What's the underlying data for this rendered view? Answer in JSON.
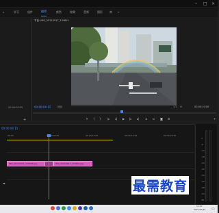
{
  "menu": {
    "items": [
      {
        "label": "学习",
        "active": false
      },
      {
        "label": "组件",
        "active": false
      },
      {
        "label": "编辑",
        "active": true
      },
      {
        "label": "颜色",
        "active": false
      },
      {
        "label": "效果",
        "active": false
      },
      {
        "label": "音频",
        "active": false
      },
      {
        "label": "图形",
        "active": false
      },
      {
        "label": "库",
        "active": false
      }
    ],
    "overflow": "»"
  },
  "program_monitor": {
    "title": "节目: IMG_20210917_134601",
    "timecode_current": "00:00:04:15",
    "fit_label": "适合",
    "quality_label": "1/2",
    "timecode_duration": "00:00:10:00"
  },
  "source_panel": {
    "timecode": "00:00:00:00"
  },
  "timeline": {
    "timecode": "00:00:04:15",
    "ruler_ticks": [
      "00:00",
      "00:00:05:00",
      "00:00:10:00",
      "00:00:15:00",
      "00:00:20:00",
      "00:00:25:00"
    ],
    "clips": [
      {
        "name": "IMG_20210917_134546.jpg"
      },
      {
        "name": "IMG_20210917_134601.jpg"
      }
    ]
  },
  "meter_labels": [
    "0",
    "-6",
    "-12",
    "-18",
    "-24",
    "-30",
    "-36",
    "-42",
    "-48",
    "-54",
    "dB"
  ],
  "controls": {
    "icons": [
      "marker-icon",
      "in-point-icon",
      "out-point-icon",
      "go-to-in-icon",
      "step-back-icon",
      "play-icon",
      "step-forward-icon",
      "go-to-out-icon",
      "lift-icon",
      "extract-icon",
      "export-frame-icon",
      "button-editor-icon"
    ]
  },
  "taskbar": {
    "time": "11:07",
    "date": "2021/10/15"
  },
  "watermark": "最需教育",
  "colors": {
    "accent": "#3b8dff",
    "clip": "#d55bbd",
    "workarea": "#d7d000"
  }
}
